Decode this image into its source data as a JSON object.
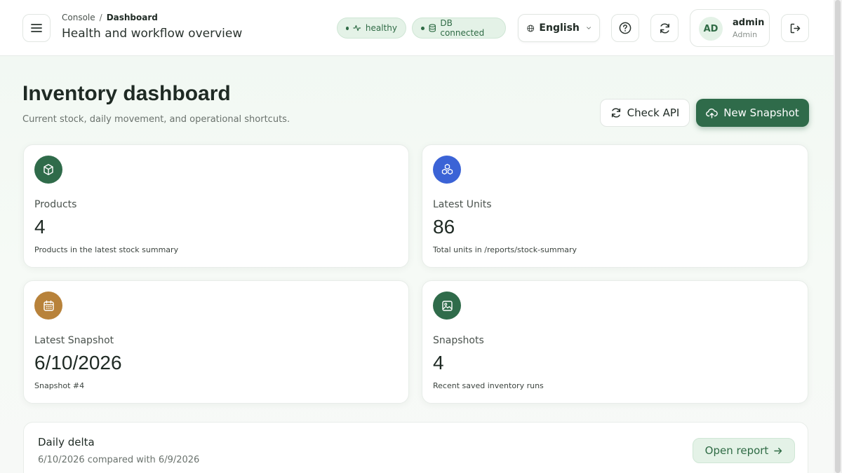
{
  "header": {
    "breadcrumb": [
      "Console",
      "Dashboard"
    ],
    "breadcrumb_sep": "/",
    "subtitle": "Health and workflow overview",
    "status_health": "healthy",
    "status_db": "DB connected",
    "language": "English",
    "user": {
      "initials": "AD",
      "name": "admin",
      "role": "Admin"
    }
  },
  "main": {
    "title": "Inventory dashboard",
    "description": "Current stock, daily movement, and operational shortcuts.",
    "check_api_label": "Check API",
    "new_snapshot_label": "New Snapshot",
    "cards": [
      {
        "label": "Products",
        "value": "4",
        "note": "Products in the latest stock summary",
        "icon": "box-icon",
        "color": "#2f6b4a"
      },
      {
        "label": "Latest Units",
        "value": "86",
        "note": "Total units in /reports/stock-summary",
        "icon": "boxes-icon",
        "color": "#3b63d6"
      },
      {
        "label": "Latest Snapshot",
        "value": "6/10/2026",
        "note": "Snapshot #4",
        "icon": "calendar-icon",
        "color": "#b8823a"
      },
      {
        "label": "Snapshots",
        "value": "4",
        "note": "Recent saved inventory runs",
        "icon": "image-icon",
        "color": "#2f6b4a"
      }
    ],
    "delta": {
      "title": "Daily delta",
      "subtitle": "6/10/2026 compared with 6/9/2026",
      "button_label": "Open report"
    }
  },
  "colors": {
    "accent": "#2f6b4a",
    "pill_bg": "#e4f2e7"
  }
}
